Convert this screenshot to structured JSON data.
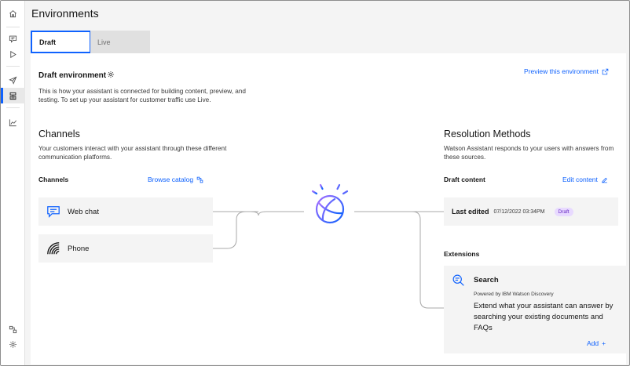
{
  "header": {
    "title": "Environments"
  },
  "tabs": [
    {
      "label": "Draft",
      "selected": true
    },
    {
      "label": "Live",
      "selected": false
    }
  ],
  "environment": {
    "title": "Draft environment",
    "description": "This is how your assistant is connected for building content, preview, and testing. To set up your assistant for customer traffic use Live.",
    "preview_link": "Preview this environment"
  },
  "channels": {
    "title": "Channels",
    "description": "Your customers interact with your assistant through these different communication platforms.",
    "sub_label": "Channels",
    "browse_link": "Browse catalog",
    "items": [
      {
        "label": "Web chat",
        "icon": "chat-icon"
      },
      {
        "label": "Phone",
        "icon": "phone-signal-icon"
      }
    ]
  },
  "resolution": {
    "title": "Resolution Methods",
    "description": "Watson Assistant responds to your users with answers from these sources.",
    "draft_content_label": "Draft content",
    "edit_link": "Edit content",
    "last_edited_label": "Last edited",
    "last_edited_date": "07/12/2022 03:34PM",
    "status_badge": "Draft"
  },
  "extensions": {
    "label": "Extensions",
    "search": {
      "title": "Search",
      "subtitle": "Powered by IBM Watson Discovery",
      "description": "Extend what your assistant can answer by searching your existing documents and FAQs",
      "add_link": "Add"
    }
  },
  "colors": {
    "accent": "#0f62fe",
    "badge_bg": "#e8daff",
    "badge_text": "#6929c4",
    "tile_bg": "#f4f4f4"
  }
}
